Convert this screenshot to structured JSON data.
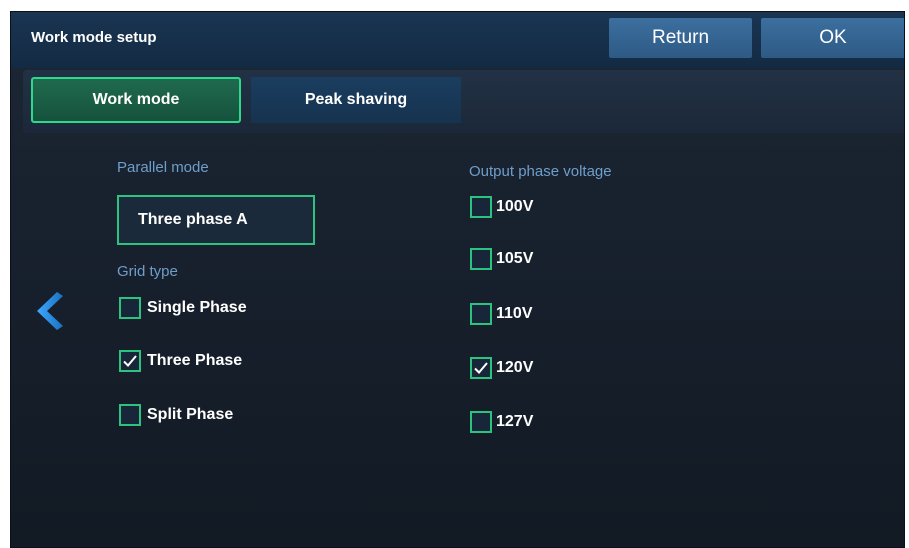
{
  "header": {
    "title": "Work mode setup",
    "return_label": "Return",
    "ok_label": "OK"
  },
  "tabs": [
    {
      "label": "Work mode",
      "active": true
    },
    {
      "label": "Peak shaving",
      "active": false
    }
  ],
  "parallel_mode": {
    "label": "Parallel mode",
    "value": "Three phase A"
  },
  "grid_type": {
    "label": "Grid type",
    "options": [
      {
        "label": "Single Phase",
        "checked": false
      },
      {
        "label": "Three Phase",
        "checked": true
      },
      {
        "label": "Split Phase",
        "checked": false
      }
    ]
  },
  "output_phase_voltage": {
    "label": "Output phase voltage",
    "options": [
      {
        "label": "100V",
        "checked": false
      },
      {
        "label": "105V",
        "checked": false
      },
      {
        "label": "110V",
        "checked": false
      },
      {
        "label": "120V",
        "checked": true
      },
      {
        "label": "127V",
        "checked": false
      }
    ]
  },
  "icons": {
    "back": "chevron-left-icon",
    "check": "checkmark-icon"
  },
  "colors": {
    "accent_green": "#2cc37f",
    "label_blue": "#6f9ec9",
    "header_button": "#3c6f9f",
    "back_arrow": "#2a8fe0"
  }
}
